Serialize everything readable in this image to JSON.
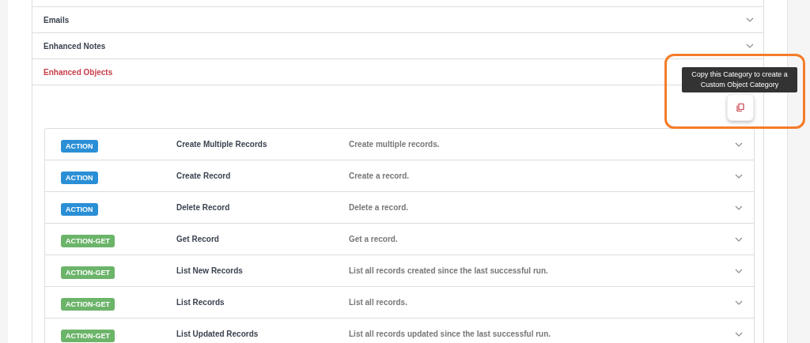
{
  "categories": [
    {
      "label": "Emails",
      "expanded": false
    },
    {
      "label": "Enhanced Notes",
      "expanded": false
    },
    {
      "label": "Enhanced Objects",
      "expanded": true
    }
  ],
  "tooltip": "Copy this Category to create a Custom Object Category",
  "operations": [
    {
      "kind": "action",
      "badge": "ACTION",
      "name": "Create Multiple Records",
      "description": "Create multiple records."
    },
    {
      "kind": "action",
      "badge": "ACTION",
      "name": "Create Record",
      "description": "Create a record."
    },
    {
      "kind": "action",
      "badge": "ACTION",
      "name": "Delete Record",
      "description": "Delete a record."
    },
    {
      "kind": "action-get",
      "badge": "ACTION-GET",
      "name": "Get Record",
      "description": "Get a record."
    },
    {
      "kind": "action-get",
      "badge": "ACTION-GET",
      "name": "List New Records",
      "description": "List all records created since the last successful run."
    },
    {
      "kind": "action-get",
      "badge": "ACTION-GET",
      "name": "List Records",
      "description": "List all records."
    },
    {
      "kind": "action-get",
      "badge": "ACTION-GET",
      "name": "List Updated Records",
      "description": "List all records updated since the last successful run."
    }
  ]
}
